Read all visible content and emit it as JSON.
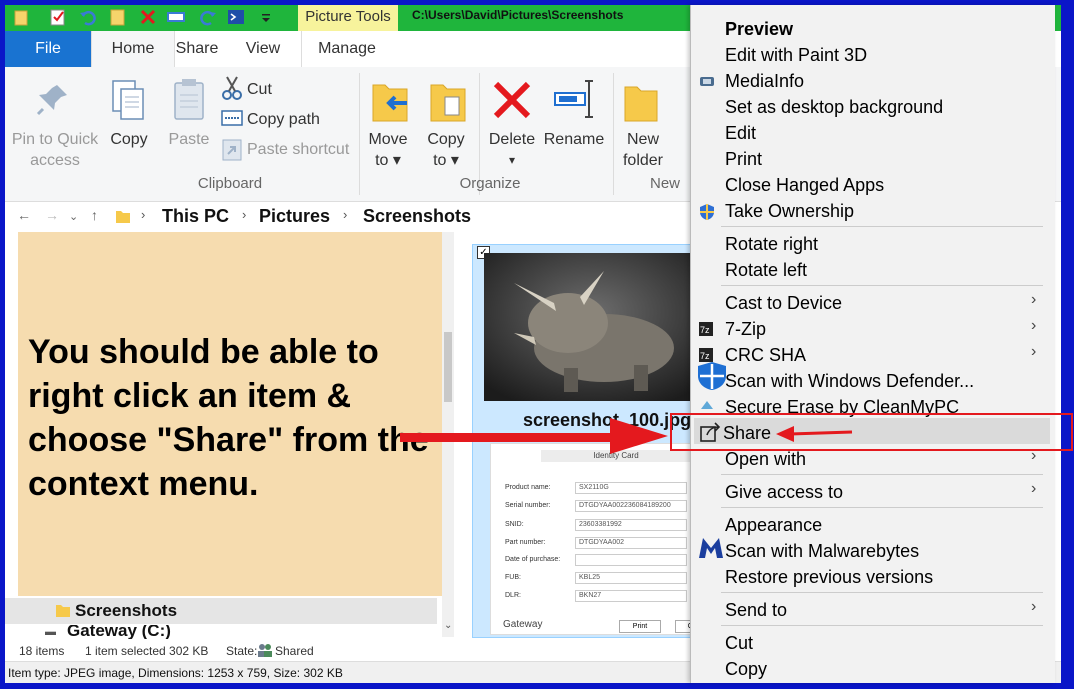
{
  "window": {
    "picture_tools": "Picture Tools",
    "path_title": "C:\\Users\\David\\Pictures\\Screenshots"
  },
  "tabs": {
    "file": "File",
    "home": "Home",
    "share": "Share",
    "view": "View",
    "manage": "Manage"
  },
  "ribbon": {
    "pin": [
      "Pin to Quick",
      "access"
    ],
    "copy": "Copy",
    "paste": "Paste",
    "cut": "Cut",
    "copy_path": "Copy path",
    "paste_shortcut": "Paste shortcut",
    "move_to": [
      "Move",
      "to ▾"
    ],
    "copy_to": [
      "Copy",
      "to ▾"
    ],
    "delete": "Delete",
    "delete_arrow": "▾",
    "rename": "Rename",
    "new_folder": [
      "New",
      "folder"
    ],
    "groups": {
      "clipboard": "Clipboard",
      "organize": "Organize",
      "new": "New"
    }
  },
  "address": {
    "crumbs": [
      "This PC",
      "Pictures",
      "Screenshots"
    ]
  },
  "callout": {
    "text": "You should be able to right click an item & choose \"Share\" from the context menu."
  },
  "navpane": {
    "selected": "Screenshots",
    "next": "Gateway (C:)"
  },
  "file": {
    "name": "screenshot_100.jpg",
    "doc_title": "Identity Card",
    "doc_rows": [
      {
        "label": "Product name:",
        "value": "SX2110G"
      },
      {
        "label": "Serial number:",
        "value": "DTGDYAA002236084189200"
      },
      {
        "label": "SNID:",
        "value": "23603381992"
      },
      {
        "label": "Part number:",
        "value": "DTGDYAA002"
      },
      {
        "label": "Date of purchase:",
        "value": ""
      },
      {
        "label": "FUB:",
        "value": "KBL25"
      },
      {
        "label": "DLR:",
        "value": "BKN27"
      }
    ],
    "brand": "Gateway",
    "print_btn": "Print",
    "close_btn": "Cl"
  },
  "status": {
    "items": "18 items",
    "selected": "1 item selected  302 KB",
    "state_label": "State:",
    "state_value": "Shared",
    "detail": "Item type: JPEG image, Dimensions: 1253 x 759, Size: 302 KB"
  },
  "context_menu": {
    "items": [
      {
        "label": "Preview"
      },
      {
        "label": "Edit with Paint 3D"
      },
      {
        "label": "MediaInfo"
      },
      {
        "label": "Set as desktop background"
      },
      {
        "label": "Edit"
      },
      {
        "label": "Print"
      },
      {
        "label": "Close Hanged Apps"
      },
      {
        "label": "Take Ownership"
      },
      {
        "label": "Rotate right"
      },
      {
        "label": "Rotate left"
      },
      {
        "label": "Cast to Device"
      },
      {
        "label": "7-Zip"
      },
      {
        "label": "CRC SHA"
      },
      {
        "label": "Scan with Windows Defender..."
      },
      {
        "label": "Secure Erase by CleanMyPC"
      },
      {
        "label": "Share"
      },
      {
        "label": "Open with"
      },
      {
        "label": "Give access to"
      },
      {
        "label": "Appearance"
      },
      {
        "label": "Scan with Malwarebytes"
      },
      {
        "label": "Restore previous versions"
      },
      {
        "label": "Send to"
      },
      {
        "label": "Cut"
      },
      {
        "label": "Copy"
      }
    ],
    "submenu_arrow": "›"
  },
  "colors": {
    "accent": "#1973d1",
    "annotation": "#e4191e",
    "callout_bg": "#f6dcaf",
    "title_green": "#1fb53c",
    "frame_blue": "#0a16c8"
  }
}
